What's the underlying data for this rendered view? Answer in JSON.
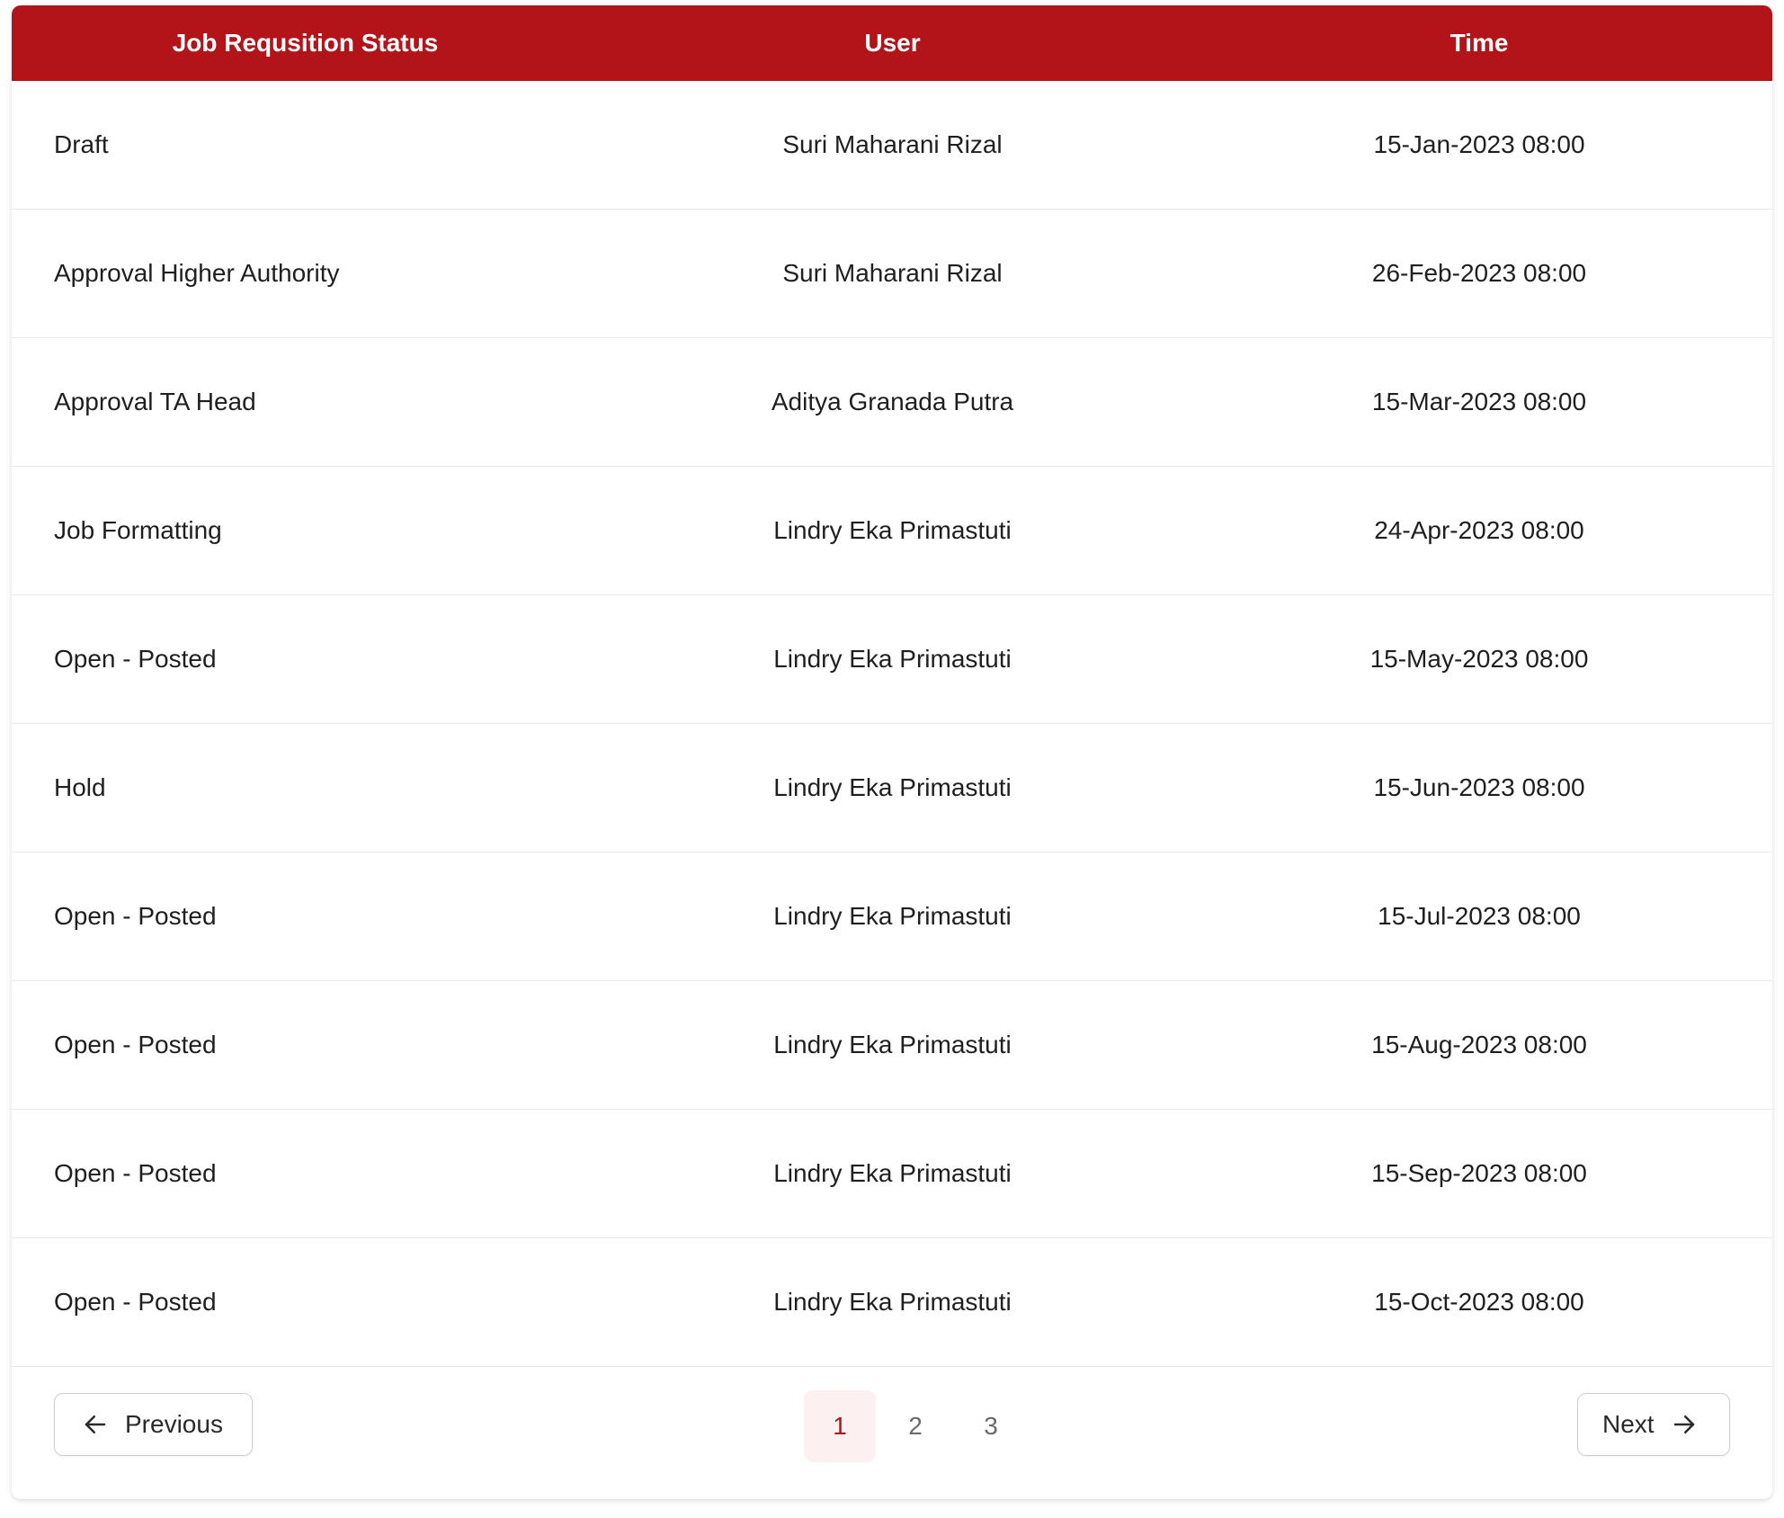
{
  "table": {
    "headers": {
      "status": "Job Requsition Status",
      "user": "User",
      "time": "Time"
    },
    "rows": [
      {
        "status": "Draft",
        "user": "Suri Maharani Rizal",
        "time": "15-Jan-2023 08:00"
      },
      {
        "status": "Approval Higher Authority",
        "user": "Suri Maharani Rizal",
        "time": "26-Feb-2023 08:00"
      },
      {
        "status": "Approval TA Head",
        "user": "Aditya Granada Putra",
        "time": "15-Mar-2023 08:00"
      },
      {
        "status": "Job Formatting",
        "user": "Lindry Eka Primastuti",
        "time": "24-Apr-2023 08:00"
      },
      {
        "status": "Open - Posted",
        "user": "Lindry Eka Primastuti",
        "time": "15-May-2023 08:00"
      },
      {
        "status": "Hold",
        "user": "Lindry Eka Primastuti",
        "time": "15-Jun-2023 08:00"
      },
      {
        "status": "Open - Posted",
        "user": "Lindry Eka Primastuti",
        "time": "15-Jul-2023 08:00"
      },
      {
        "status": "Open - Posted",
        "user": "Lindry Eka Primastuti",
        "time": "15-Aug-2023 08:00"
      },
      {
        "status": "Open - Posted",
        "user": "Lindry Eka Primastuti",
        "time": "15-Sep-2023 08:00"
      },
      {
        "status": "Open - Posted",
        "user": "Lindry Eka Primastuti",
        "time": "15-Oct-2023 08:00"
      }
    ]
  },
  "pagination": {
    "previous_label": "Previous",
    "next_label": "Next",
    "previous_icon": "arrow-left-icon",
    "next_icon": "arrow-right-icon",
    "pages": [
      "1",
      "2",
      "3"
    ],
    "current_page": "1"
  },
  "colors": {
    "header_bg": "#b2141a",
    "active_page_bg": "#fdf0f0",
    "active_page_text": "#b2141a"
  }
}
